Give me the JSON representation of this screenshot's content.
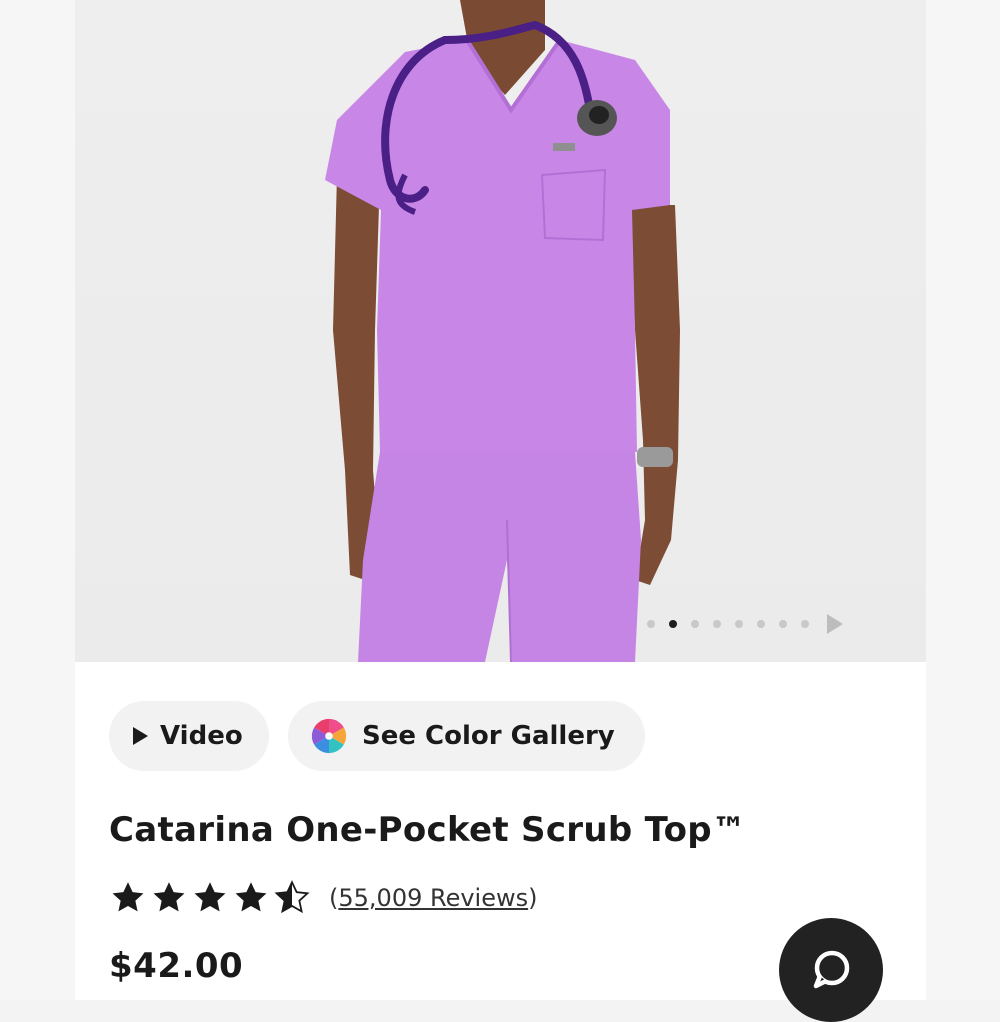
{
  "product": {
    "title": "Catarina One-Pocket Scrub Top™",
    "price": "$42.00",
    "rating": {
      "value": 4.5,
      "max": 5,
      "reviews_label": "(55,009 Reviews)",
      "reviews_open": "(",
      "reviews_count": "55,009 Reviews",
      "reviews_close": ")"
    }
  },
  "media_buttons": {
    "video_label": "Video",
    "gallery_label": "See Color Gallery"
  },
  "carousel": {
    "total": 8,
    "active_index": 1
  },
  "icons": {
    "play": "play-icon",
    "gallery": "color-wheel-icon",
    "star": "star-icon",
    "next": "next-arrow-icon",
    "chat": "chat-bubble-icon"
  },
  "colors": {
    "scrub": "#c887e6",
    "text": "#1a1a1a",
    "chat_bg": "#222222",
    "pill_bg": "#f2f2f2"
  }
}
